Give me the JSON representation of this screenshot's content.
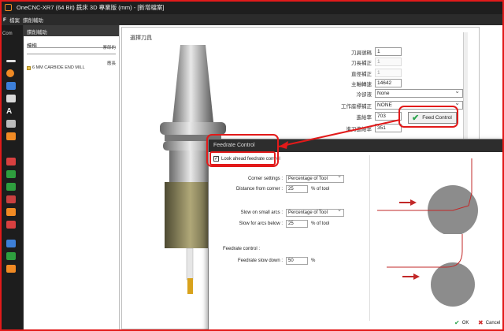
{
  "window": {
    "title": "OneCNC-XR7 (64 Bit) 銑床 3D 專業版 (mm) - [新增檔案]",
    "menu_first": "F",
    "menu_second": "檔案",
    "menu_third": "鑽削輔助"
  },
  "toolbar": {
    "label": "Com"
  },
  "tree": {
    "header": "鑽削輔助",
    "heading": "檯楷",
    "meta_top": "寨郎的",
    "meta_bottom": "應長",
    "item": "6 MM CARBIDE END MILL"
  },
  "select_tool": {
    "title": "選擇刀具",
    "fields": [
      {
        "label": "刀具號碼",
        "value": "1",
        "enabled": true
      },
      {
        "label": "刀長補正",
        "value": "1",
        "enabled": false
      },
      {
        "label": "直徑補正",
        "value": "1",
        "enabled": false
      },
      {
        "label": "主軸轉速",
        "value": "14642",
        "enabled": true
      }
    ],
    "coolant": {
      "label": "冷卻液",
      "value": "None"
    },
    "work_offset": {
      "label": "工作座標補正",
      "value": "NONE"
    },
    "feed": {
      "label": "進給率",
      "value": "703"
    },
    "plunge": {
      "label": "進刀進給率",
      "value": "351"
    },
    "feed_button": "Feed Control"
  },
  "dialog": {
    "title": "Feedrate Control",
    "lookahead_label": "Look ahead feedrate control",
    "lookahead_checked": true,
    "corner_settings_label": "Corner settings :",
    "corner_settings_value": "Percentage of Tool",
    "distance_label": "Distance from corner :",
    "distance_value": "25",
    "distance_unit": "% of tool",
    "slow_arcs_label": "Slow on small arcs :",
    "slow_arcs_value": "Percentage of Tool",
    "arcs_below_label": "Slow for arcs below :",
    "arcs_below_value": "25",
    "arcs_below_unit": "% of tool",
    "feedrate_control_label": "Feedrate control :",
    "slowdown_label": "Feedrate slow down :",
    "slowdown_value": "50",
    "slowdown_unit": "%",
    "ok_label": "OK",
    "cancel_label": "Cancel"
  },
  "colors": {
    "highlight_red": "#e21a1a",
    "dark_ui": "#1e1e1e",
    "check_green": "#2da44e",
    "diagram_circle": "#8c8c8c"
  }
}
